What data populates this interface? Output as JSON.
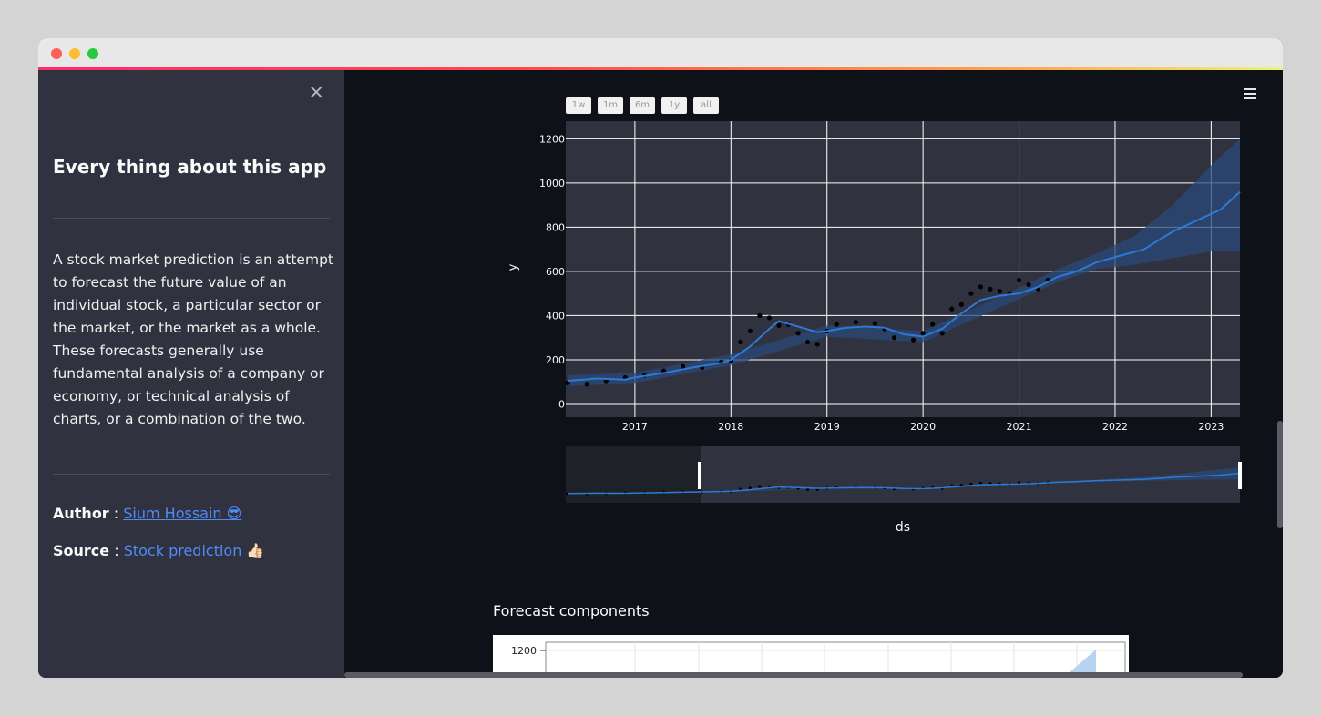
{
  "window": {
    "traffic_lights": [
      "close",
      "minimize",
      "maximize"
    ]
  },
  "sidebar": {
    "close_icon": "×",
    "title": "Every thing about this app",
    "description": "A stock market prediction is an attempt to forecast the future value of an individual stock, a particular sector or the market, or the market as a whole. These forecasts generally use fundamental analysis of a company or economy, or technical analysis of charts, or a combination of the two.",
    "author_label": "Author",
    "author_link": "Sium Hossain 😎",
    "source_label": "Source",
    "source_link": "Stock prediction 👍🏻",
    "separator": " : "
  },
  "main": {
    "menu_icon": "hamburger-menu-icon",
    "range_selector": [
      "1w",
      "1m",
      "6m",
      "1y",
      "all"
    ],
    "forecast_components_title": "Forecast components",
    "components_chart": {
      "y_tick_label": "1200"
    }
  },
  "chart_data": {
    "type": "line",
    "xlabel": "ds",
    "ylabel": "y",
    "ylim": [
      -60,
      1280
    ],
    "xlim": [
      2016.28,
      2023.3
    ],
    "x_ticks": [
      "2017",
      "2018",
      "2019",
      "2020",
      "2021",
      "2022",
      "2023"
    ],
    "y_ticks": [
      "0",
      "200",
      "400",
      "600",
      "800",
      "1000",
      "1200"
    ],
    "grid": true,
    "colors": {
      "forecast": "#2c7ad6",
      "band": "#2a4a7a",
      "actual": "#000000",
      "plot_bg": "#31323f"
    },
    "series": [
      {
        "role": "forecast yhat",
        "x": [
          2016.3,
          2016.6,
          2016.9,
          2017.0,
          2017.3,
          2017.6,
          2017.9,
          2018.0,
          2018.2,
          2018.4,
          2018.5,
          2018.7,
          2018.9,
          2019.0,
          2019.2,
          2019.4,
          2019.6,
          2019.8,
          2020.0,
          2020.2,
          2020.4,
          2020.6,
          2020.8,
          2021.0,
          2021.2,
          2021.4,
          2021.6,
          2021.8,
          2022.0,
          2022.3,
          2022.6,
          2022.9,
          2023.1,
          2023.3
        ],
        "y": [
          105,
          115,
          110,
          120,
          140,
          165,
          185,
          200,
          260,
          340,
          375,
          350,
          325,
          330,
          345,
          350,
          345,
          315,
          305,
          340,
          410,
          470,
          490,
          500,
          530,
          575,
          600,
          640,
          665,
          700,
          780,
          840,
          880,
          960
        ]
      },
      {
        "role": "uncertainty upper",
        "x": [
          2016.3,
          2017.0,
          2018.0,
          2019.0,
          2020.0,
          2021.0,
          2021.4,
          2021.8,
          2022.2,
          2022.6,
          2023.0,
          2023.3
        ],
        "y": [
          130,
          140,
          225,
          355,
          330,
          525,
          610,
          680,
          760,
          900,
          1080,
          1200
        ]
      },
      {
        "role": "uncertainty lower",
        "x": [
          2016.3,
          2017.0,
          2018.0,
          2019.0,
          2020.0,
          2021.0,
          2021.4,
          2021.8,
          2022.2,
          2022.6,
          2023.0,
          2023.3
        ],
        "y": [
          80,
          95,
          175,
          305,
          280,
          475,
          550,
          610,
          630,
          660,
          690,
          690
        ]
      },
      {
        "role": "actual observations",
        "x": [
          2016.3,
          2016.5,
          2016.7,
          2016.9,
          2017.1,
          2017.3,
          2017.5,
          2017.7,
          2017.9,
          2018.0,
          2018.1,
          2018.2,
          2018.3,
          2018.4,
          2018.5,
          2018.6,
          2018.7,
          2018.8,
          2018.9,
          2019.0,
          2019.1,
          2019.3,
          2019.5,
          2019.6,
          2019.7,
          2019.9,
          2020.0,
          2020.1,
          2020.2,
          2020.3,
          2020.4,
          2020.5,
          2020.6,
          2020.7,
          2020.8,
          2020.9,
          2021.0,
          2021.1,
          2021.2,
          2021.3
        ],
        "y": [
          95,
          90,
          105,
          120,
          130,
          150,
          170,
          165,
          190,
          195,
          280,
          330,
          400,
          390,
          355,
          360,
          320,
          280,
          270,
          330,
          360,
          370,
          365,
          340,
          300,
          290,
          320,
          360,
          320,
          430,
          450,
          500,
          530,
          520,
          510,
          500,
          560,
          540,
          520,
          560
        ]
      }
    ]
  }
}
